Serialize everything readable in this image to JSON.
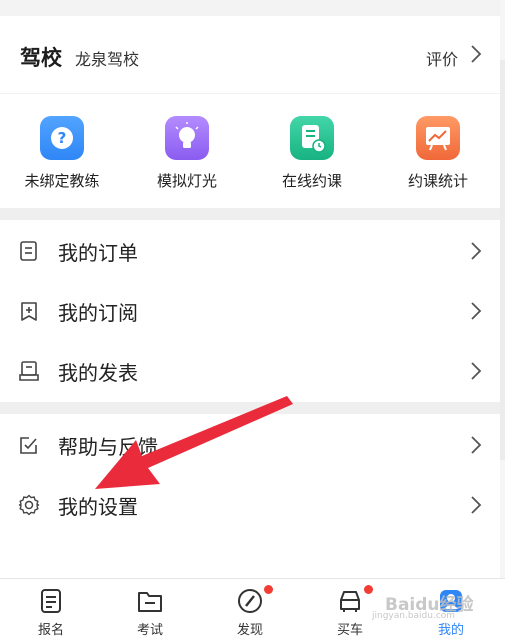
{
  "school": {
    "title": "驾校",
    "name": "龙泉驾校",
    "rate_label": "评价"
  },
  "quick_actions": [
    {
      "label": "未绑定教练",
      "icon": "question-icon",
      "color": "#2f86f6"
    },
    {
      "label": "模拟灯光",
      "icon": "bulb-icon",
      "color": "#9b6cf7"
    },
    {
      "label": "在线约课",
      "icon": "schedule-icon",
      "color": "#23c18e"
    },
    {
      "label": "约课统计",
      "icon": "chart-icon",
      "color": "#f2713c"
    }
  ],
  "menu": [
    {
      "label": "我的订单",
      "icon": "order-icon"
    },
    {
      "label": "我的订阅",
      "icon": "bookmark-icon"
    },
    {
      "label": "我的发表",
      "icon": "publish-icon"
    },
    {
      "label": "帮助与反馈",
      "icon": "feedback-icon"
    },
    {
      "label": "我的设置",
      "icon": "settings-icon"
    }
  ],
  "tabs": [
    {
      "label": "报名",
      "icon": "signup-icon",
      "badge": false
    },
    {
      "label": "考试",
      "icon": "folder-icon",
      "badge": false
    },
    {
      "label": "发现",
      "icon": "compass-icon",
      "badge": true
    },
    {
      "label": "买车",
      "icon": "car-icon",
      "badge": true
    },
    {
      "label": "我的",
      "icon": "profile-icon",
      "badge": false,
      "active": true
    }
  ],
  "watermark": {
    "brand": "Baidu经验",
    "url": "jingyan.baidu.com"
  },
  "colors": {
    "accent": "#2f86f6",
    "badge": "#f23c34",
    "annotation_arrow": "#ea2b3b"
  }
}
